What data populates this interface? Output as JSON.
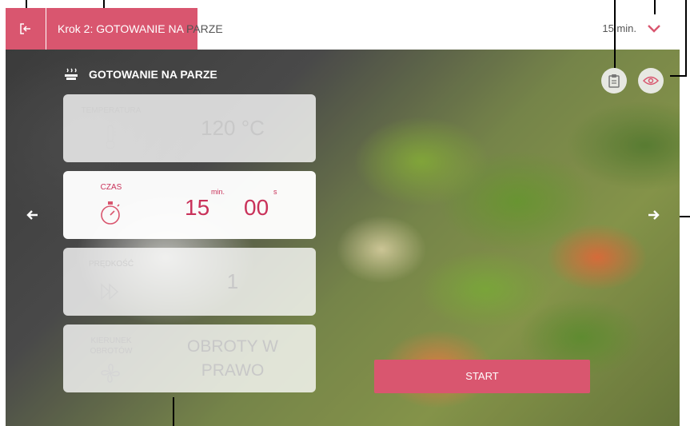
{
  "topbar": {
    "step_title_highlight": "Krok 2: GOTOWANIE NA",
    "step_title_rest": " PARZE",
    "duration": "15 min."
  },
  "section": {
    "title": "GOTOWANIE NA PARZE"
  },
  "params": {
    "temperature": {
      "label": "TEMPERATURA",
      "value": "120 °C"
    },
    "time": {
      "label": "CZAS",
      "minutes": "15",
      "minutes_unit": "min.",
      "seconds": "00",
      "seconds_unit": "s"
    },
    "speed": {
      "label": "PRĘDKOŚĆ",
      "value": "1"
    },
    "direction": {
      "label": "KIERUNEK OBROTÓW",
      "value": "OBROTY W PRAWO"
    }
  },
  "actions": {
    "start_label": "START"
  },
  "colors": {
    "accent": "#d9566f",
    "active_text": "#c9325a"
  },
  "icons": [
    "exit-icon",
    "chevron-down-icon",
    "steam-icon",
    "clipboard-icon",
    "eye-icon",
    "arrow-left-icon",
    "arrow-right-icon",
    "thermometer-icon",
    "stopwatch-icon",
    "fast-forward-icon",
    "fan-icon"
  ]
}
